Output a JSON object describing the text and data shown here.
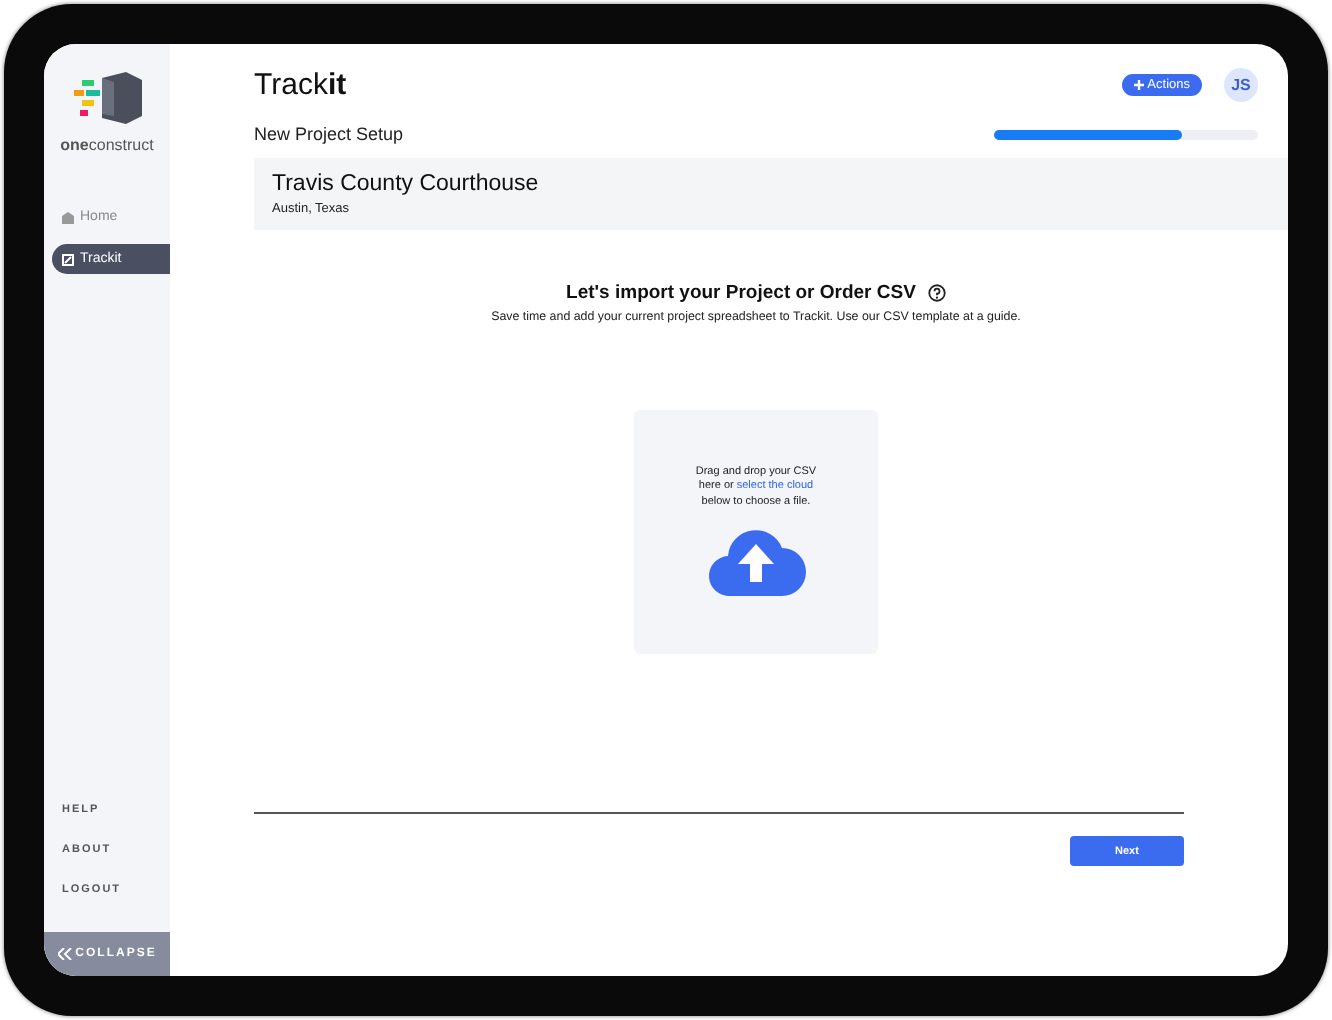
{
  "logo": {
    "wordmark": "**one**construct"
  },
  "sidebar": {
    "items": [
      {
        "label": "Home",
        "kind": "home",
        "selected": false
      },
      {
        "label": "Trackit",
        "kind": "trackit",
        "selected": true
      }
    ],
    "footer_links": [
      "HELP",
      "ABOUT",
      "LOGOUT"
    ],
    "collapse": {
      "label": "COLLAPSE"
    }
  },
  "header": {
    "title": "Track**it**",
    "actions_button": "Actions",
    "avatar": "JS"
  },
  "setup": {
    "label": "New Project Setup",
    "progress": {
      "level": 0.71
    }
  },
  "project": {
    "name": "Travis County Courthouse",
    "location": "Austin, Texas"
  },
  "import": {
    "heading": "Let's import your Project or Order CSV",
    "subtitle": "Save time and add your current project spreadsheet to Trackit. Use our CSV template at a guide.",
    "dropzone": {
      "text_before": "Drag and drop your CSV here or",
      "link": "select the cloud",
      "text_after": "below to choose a file."
    }
  },
  "footer": {
    "next_button": "Next"
  }
}
